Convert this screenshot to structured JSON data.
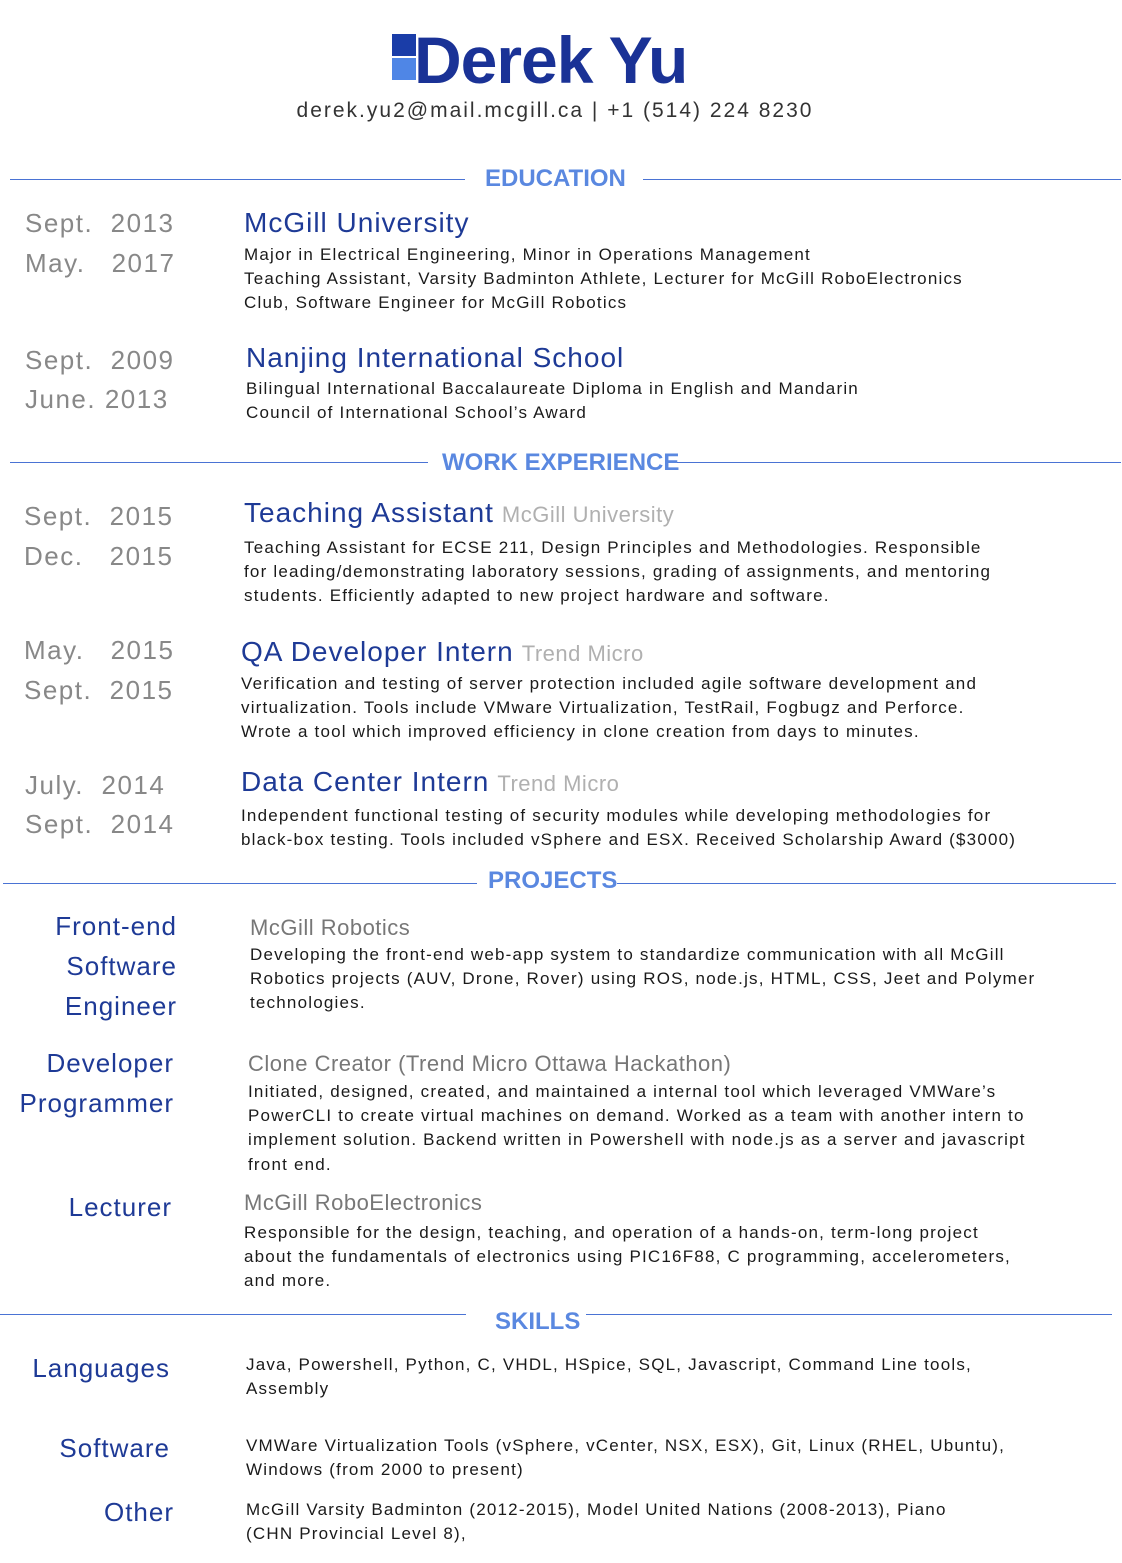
{
  "header": {
    "name": "Derek Yu",
    "contact": "derek.yu2@mail.mcgill.ca | +1 (514) 224 8230"
  },
  "colors": {
    "accent_dark": "#1a3296",
    "accent_light": "#5a88e0",
    "rule": "#4a73d4",
    "date_gray": "#888888"
  },
  "sections": {
    "education": "EDUCATION",
    "work": "WORK EXPERIENCE",
    "projects": "PROJECTS",
    "skills": "SKILLS"
  },
  "education": [
    {
      "start": "Sept.  2013",
      "end": "May.   2017",
      "title": "McGill University",
      "lines": [
        "Major in Electrical Engineering, Minor in Operations Management",
        "Teaching Assistant, Varsity Badminton Athlete, Lecturer for McGill RoboElectronics",
        "Club, Software Engineer for McGill Robotics"
      ]
    },
    {
      "start": "Sept.  2009",
      "end": "June. 2013",
      "title": "Nanjing International School",
      "lines": [
        "Bilingual International Baccalaureate Diploma in English and Mandarin",
        "Council of International School’s Award"
      ]
    }
  ],
  "work": [
    {
      "start": "Sept.  2015",
      "end": "Dec.   2015",
      "title": "Teaching Assistant",
      "org": "McGill University",
      "lines": [
        "Teaching Assistant for ECSE 211, Design Principles and Methodologies. Responsible",
        "for leading/demonstrating laboratory sessions, grading of assignments, and mentoring",
        "students. Efficiently adapted to new project hardware and software."
      ]
    },
    {
      "start": "May.   2015",
      "end": "Sept.  2015",
      "title": "QA Developer Intern",
      "org": "Trend Micro",
      "lines": [
        "Verification and testing of server protection included agile software development and",
        "virtualization. Tools include VMware Virtualization, TestRail, Fogbugz and Perforce.",
        "Wrote a tool which improved efficiency in clone creation from days to minutes."
      ]
    },
    {
      "start": "July.  2014",
      "end": "Sept.  2014",
      "title": "Data Center Intern",
      "org": "Trend Micro",
      "lines": [
        "Independent functional testing of security modules while developing methodologies for",
        "black-box testing. Tools included vSphere and ESX. Received Scholarship Award ($3000)"
      ]
    }
  ],
  "projects": [
    {
      "label": [
        "Front-end",
        "Software",
        "Engineer"
      ],
      "title": "McGill Robotics",
      "lines": [
        "Developing the front-end web-app system to standardize communication with all McGill",
        "Robotics projects (AUV, Drone, Rover) using ROS, node.js, HTML, CSS, Jeet and Polymer",
        "technologies."
      ]
    },
    {
      "label": [
        "Developer",
        "Programmer"
      ],
      "title": "Clone Creator (Trend Micro Ottawa Hackathon)",
      "lines": [
        "Initiated, designed, created, and maintained a internal tool which leveraged VMWare’s",
        "PowerCLI to create virtual machines on demand. Worked as a team with another intern to",
        "implement solution. Backend written in Powershell with node.js as a server and javascript",
        "front end."
      ]
    },
    {
      "label": [
        "Lecturer"
      ],
      "title": "McGill RoboElectronics",
      "lines": [
        "Responsible for the design, teaching, and operation of a hands-on, term-long project",
        "about the fundamentals of electronics using PIC16F88, C programming, accelerometers,",
        "and more."
      ]
    }
  ],
  "skills": [
    {
      "label": "Languages",
      "lines": [
        "Java, Powershell, Python, C, VHDL, HSpice, SQL, Javascript, Command Line tools,",
        "Assembly"
      ]
    },
    {
      "label": "Software",
      "lines": [
        "VMWare Virtualization Tools (vSphere, vCenter, NSX, ESX), Git, Linux (RHEL, Ubuntu),",
        "Windows (from 2000 to present)"
      ]
    },
    {
      "label": "Other",
      "lines": [
        "McGill Varsity Badminton (2012-2015), Model United Nations (2008-2013), Piano",
        "(CHN Provincial Level 8),"
      ]
    }
  ]
}
